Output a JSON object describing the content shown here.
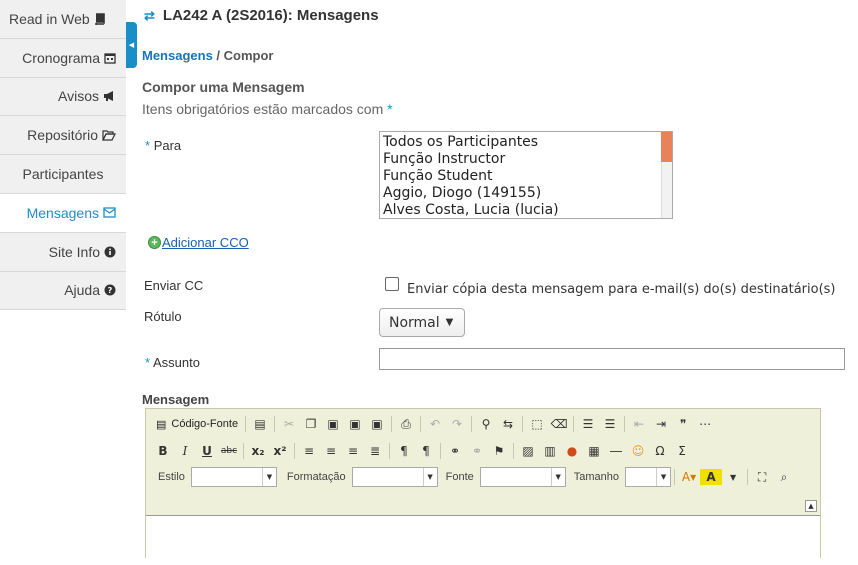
{
  "sidebar": {
    "items": [
      {
        "label": "Read in Web",
        "icon": "book-icon"
      },
      {
        "label": "Cronograma",
        "icon": "calendar-icon"
      },
      {
        "label": "Avisos",
        "icon": "megaphone-icon"
      },
      {
        "label": "Repositório",
        "icon": "folder-open-icon"
      },
      {
        "label": "Participantes",
        "icon": ""
      },
      {
        "label": "Mensagens",
        "icon": "envelope-icon",
        "active": true
      },
      {
        "label": "Site Info",
        "icon": "info-icon"
      },
      {
        "label": "Ajuda",
        "icon": "question-icon"
      }
    ],
    "active_color": "#1a8fc7"
  },
  "header": {
    "title": "LA242 A (2S2016): Mensagens"
  },
  "breadcrumb": {
    "link": "Mensagens",
    "separator": " / ",
    "current": "Compor"
  },
  "form": {
    "heading": "Compor uma Mensagem",
    "required_note": "Itens obrigatórios estão marcados com",
    "required_star": "*",
    "to_label": "Para",
    "recipients": [
      "Todos os Participantes",
      "Função Instructor",
      "Função Student",
      "Aggio, Diogo (149155)",
      "Alves Costa, Lucia (lucia)"
    ],
    "add_bcc": "Adicionar CCO",
    "cc_label": "Enviar CC",
    "cc_checkbox_text": "Enviar cópia desta mensagem para e-mail(s) do(s) destinatário(s)",
    "cc_checked": false,
    "label_label": "Rótulo",
    "label_value": "Normal",
    "subject_label": "Assunto",
    "subject_value": "",
    "message_label": "Mensagem"
  },
  "editor": {
    "source_button": "Código-Fonte",
    "style_label": "Estilo",
    "format_label": "Formatação",
    "font_label": "Fonte",
    "size_label": "Tamanho",
    "bold": "B",
    "italic": "I",
    "underline": "U",
    "strike": "abc",
    "subscript": "x₂",
    "superscript": "x²"
  }
}
